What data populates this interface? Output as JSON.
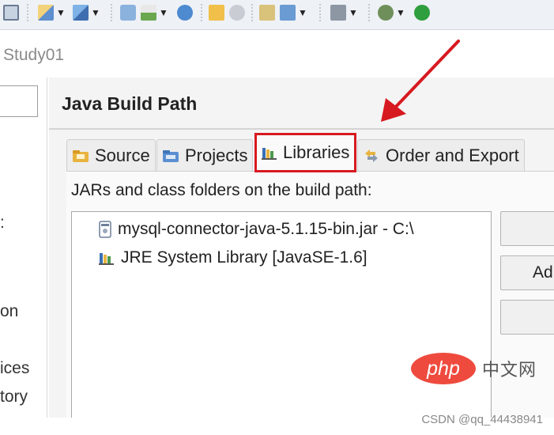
{
  "window": {
    "title": "Study01"
  },
  "toolbar": {
    "icons": [
      "calendar-icon",
      "new-wizard-icon",
      "run-wizard-icon",
      "build-icon",
      "run-external-icon",
      "globe-icon",
      "open-folder-icon",
      "search-icon",
      "task-icon",
      "open-type-icon",
      "server-icon",
      "debug-icon",
      "run-icon"
    ],
    "arrow_glyph": "▼"
  },
  "left_panel": {
    "items": [
      ":",
      "on",
      "ices",
      "tory"
    ]
  },
  "dialog": {
    "title": "Java Build Path",
    "tabs": [
      {
        "label": "Source",
        "icon": "source-folder-icon"
      },
      {
        "label": "Projects",
        "icon": "projects-icon"
      },
      {
        "label": "Libraries",
        "icon": "libraries-icon",
        "active": true
      },
      {
        "label": "Order and Export",
        "icon": "order-export-icon"
      }
    ],
    "jars_label": "JARs and class folders on the build path:",
    "entries": [
      {
        "label": "mysql-connector-java-5.1.15-bin.jar - C:\\",
        "icon": "jar-file-icon"
      },
      {
        "label": "JRE System Library [JavaSE-1.6]",
        "icon": "library-icon"
      }
    ],
    "buttons": [
      "",
      "Ad",
      ""
    ]
  },
  "annotation": {
    "color": "#d71920"
  },
  "watermark": {
    "logo_text": "php",
    "cn_text": "中文网",
    "credit": "CSDN @qq_44438941"
  }
}
